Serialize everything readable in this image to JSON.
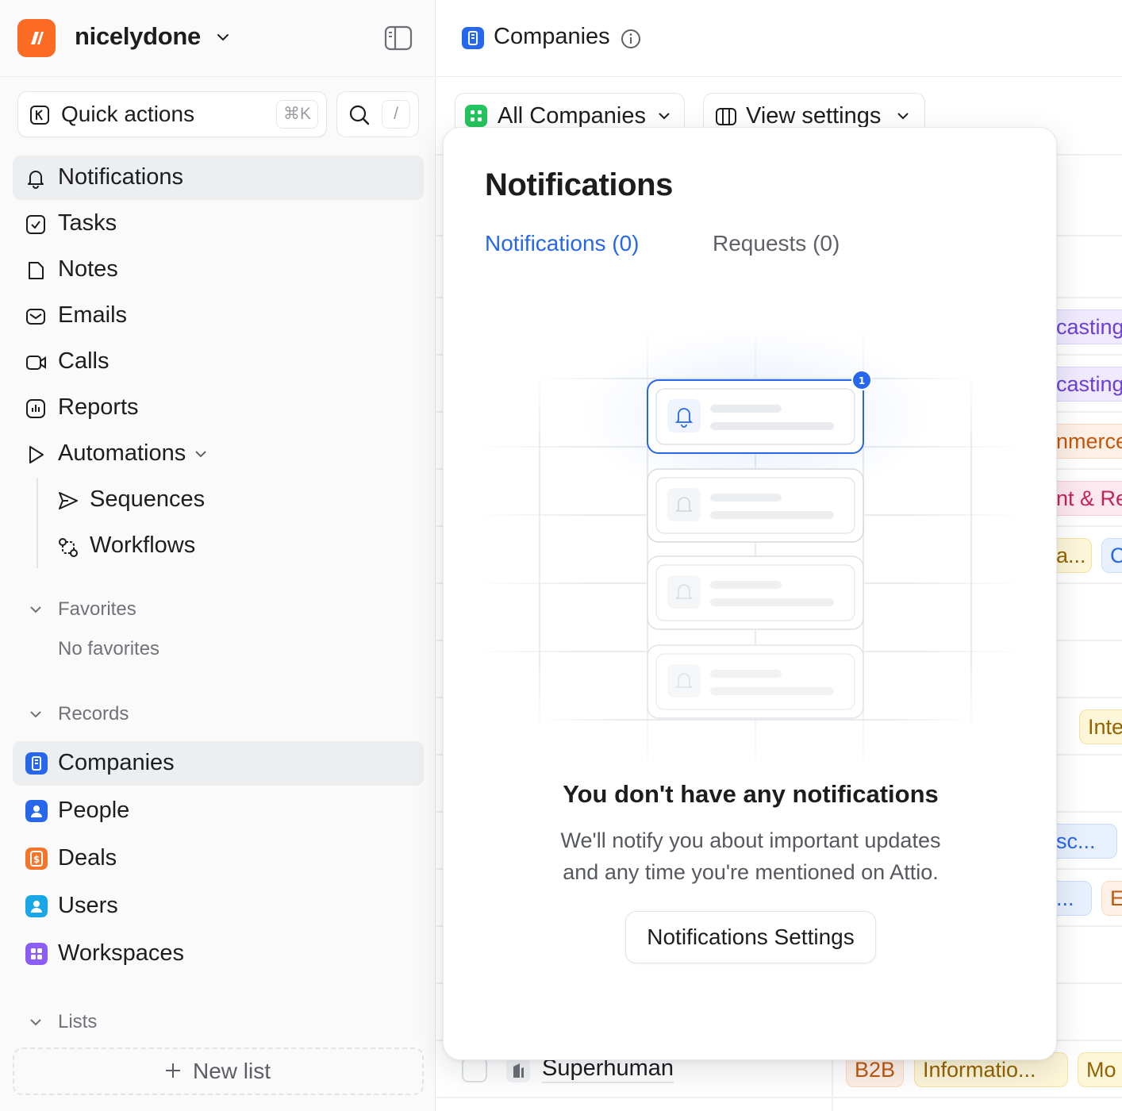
{
  "workspace": {
    "name": "nicelydone"
  },
  "quick_actions": {
    "label": "Quick actions",
    "shortcut": "⌘K"
  },
  "search": {
    "shortcut": "/"
  },
  "nav": [
    {
      "label": "Notifications",
      "icon": "bell-icon",
      "active": true
    },
    {
      "label": "Tasks",
      "icon": "checkbox-icon"
    },
    {
      "label": "Notes",
      "icon": "note-icon"
    },
    {
      "label": "Emails",
      "icon": "mail-icon"
    },
    {
      "label": "Calls",
      "icon": "video-icon"
    },
    {
      "label": "Reports",
      "icon": "chart-icon"
    },
    {
      "label": "Automations",
      "icon": "play-icon"
    }
  ],
  "automations": [
    {
      "label": "Sequences",
      "icon": "send-icon"
    },
    {
      "label": "Workflows",
      "icon": "workflow-icon"
    }
  ],
  "favorites": {
    "label": "Favorites",
    "empty": "No favorites"
  },
  "records": {
    "label": "Records",
    "items": [
      {
        "label": "Companies",
        "color": "#2667eb",
        "active": true
      },
      {
        "label": "People",
        "color": "#2667eb"
      },
      {
        "label": "Deals",
        "color": "#f4742a"
      },
      {
        "label": "Users",
        "color": "#19a7e8"
      },
      {
        "label": "Workspaces",
        "color": "#8b5cf6"
      }
    ]
  },
  "lists": {
    "label": "Lists",
    "new_list": "New list"
  },
  "main": {
    "title": "Companies",
    "view_name": "All Companies",
    "view_settings": "View settings",
    "bottom_row": {
      "company": "Superhuman",
      "tags": [
        "B2B",
        "Informatio...",
        "Mo"
      ]
    },
    "background_pills": [
      "casting",
      "casting",
      "nmerce",
      "nt & Re",
      "a...",
      "C",
      "Inte",
      "sc...",
      "...",
      "E"
    ]
  },
  "notifications_popup": {
    "title": "Notifications",
    "tabs": [
      {
        "label": "Notifications (0)",
        "active": true
      },
      {
        "label": "Requests (0)",
        "active": false
      }
    ],
    "badge": "1",
    "empty_title": "You don't have any notifications",
    "empty_desc_line1": "We'll notify you about important updates",
    "empty_desc_line2": "and any time you're mentioned on Attio.",
    "settings_button": "Notifications Settings"
  },
  "colors": {
    "accent": "#2667eb",
    "brand": "#fb6b24",
    "green": "#22c55e"
  }
}
